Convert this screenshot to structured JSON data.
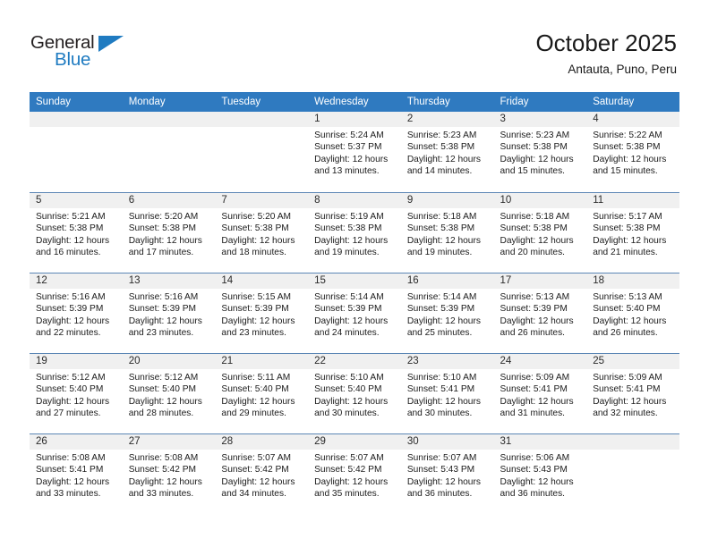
{
  "brand": {
    "name_top": "General",
    "name_bottom": "Blue",
    "triangle_icon": "triangle-icon",
    "accent_color": "#1f7bc1"
  },
  "header": {
    "title": "October 2025",
    "location": "Antauta, Puno, Peru"
  },
  "calendar": {
    "header_bg": "#2f7ac0",
    "day_band_bg": "#f0f0f0",
    "row_divider": "#5b86b5",
    "weekdays": [
      "Sunday",
      "Monday",
      "Tuesday",
      "Wednesday",
      "Thursday",
      "Friday",
      "Saturday"
    ],
    "weeks": [
      [
        {
          "day": "",
          "blank": true
        },
        {
          "day": "",
          "blank": true
        },
        {
          "day": "",
          "blank": true
        },
        {
          "day": "1",
          "sunrise": "Sunrise: 5:24 AM",
          "sunset": "Sunset: 5:37 PM",
          "daylight": "Daylight: 12 hours and 13 minutes."
        },
        {
          "day": "2",
          "sunrise": "Sunrise: 5:23 AM",
          "sunset": "Sunset: 5:38 PM",
          "daylight": "Daylight: 12 hours and 14 minutes."
        },
        {
          "day": "3",
          "sunrise": "Sunrise: 5:23 AM",
          "sunset": "Sunset: 5:38 PM",
          "daylight": "Daylight: 12 hours and 15 minutes."
        },
        {
          "day": "4",
          "sunrise": "Sunrise: 5:22 AM",
          "sunset": "Sunset: 5:38 PM",
          "daylight": "Daylight: 12 hours and 15 minutes."
        }
      ],
      [
        {
          "day": "5",
          "sunrise": "Sunrise: 5:21 AM",
          "sunset": "Sunset: 5:38 PM",
          "daylight": "Daylight: 12 hours and 16 minutes."
        },
        {
          "day": "6",
          "sunrise": "Sunrise: 5:20 AM",
          "sunset": "Sunset: 5:38 PM",
          "daylight": "Daylight: 12 hours and 17 minutes."
        },
        {
          "day": "7",
          "sunrise": "Sunrise: 5:20 AM",
          "sunset": "Sunset: 5:38 PM",
          "daylight": "Daylight: 12 hours and 18 minutes."
        },
        {
          "day": "8",
          "sunrise": "Sunrise: 5:19 AM",
          "sunset": "Sunset: 5:38 PM",
          "daylight": "Daylight: 12 hours and 19 minutes."
        },
        {
          "day": "9",
          "sunrise": "Sunrise: 5:18 AM",
          "sunset": "Sunset: 5:38 PM",
          "daylight": "Daylight: 12 hours and 19 minutes."
        },
        {
          "day": "10",
          "sunrise": "Sunrise: 5:18 AM",
          "sunset": "Sunset: 5:38 PM",
          "daylight": "Daylight: 12 hours and 20 minutes."
        },
        {
          "day": "11",
          "sunrise": "Sunrise: 5:17 AM",
          "sunset": "Sunset: 5:38 PM",
          "daylight": "Daylight: 12 hours and 21 minutes."
        }
      ],
      [
        {
          "day": "12",
          "sunrise": "Sunrise: 5:16 AM",
          "sunset": "Sunset: 5:39 PM",
          "daylight": "Daylight: 12 hours and 22 minutes."
        },
        {
          "day": "13",
          "sunrise": "Sunrise: 5:16 AM",
          "sunset": "Sunset: 5:39 PM",
          "daylight": "Daylight: 12 hours and 23 minutes."
        },
        {
          "day": "14",
          "sunrise": "Sunrise: 5:15 AM",
          "sunset": "Sunset: 5:39 PM",
          "daylight": "Daylight: 12 hours and 23 minutes."
        },
        {
          "day": "15",
          "sunrise": "Sunrise: 5:14 AM",
          "sunset": "Sunset: 5:39 PM",
          "daylight": "Daylight: 12 hours and 24 minutes."
        },
        {
          "day": "16",
          "sunrise": "Sunrise: 5:14 AM",
          "sunset": "Sunset: 5:39 PM",
          "daylight": "Daylight: 12 hours and 25 minutes."
        },
        {
          "day": "17",
          "sunrise": "Sunrise: 5:13 AM",
          "sunset": "Sunset: 5:39 PM",
          "daylight": "Daylight: 12 hours and 26 minutes."
        },
        {
          "day": "18",
          "sunrise": "Sunrise: 5:13 AM",
          "sunset": "Sunset: 5:40 PM",
          "daylight": "Daylight: 12 hours and 26 minutes."
        }
      ],
      [
        {
          "day": "19",
          "sunrise": "Sunrise: 5:12 AM",
          "sunset": "Sunset: 5:40 PM",
          "daylight": "Daylight: 12 hours and 27 minutes."
        },
        {
          "day": "20",
          "sunrise": "Sunrise: 5:12 AM",
          "sunset": "Sunset: 5:40 PM",
          "daylight": "Daylight: 12 hours and 28 minutes."
        },
        {
          "day": "21",
          "sunrise": "Sunrise: 5:11 AM",
          "sunset": "Sunset: 5:40 PM",
          "daylight": "Daylight: 12 hours and 29 minutes."
        },
        {
          "day": "22",
          "sunrise": "Sunrise: 5:10 AM",
          "sunset": "Sunset: 5:40 PM",
          "daylight": "Daylight: 12 hours and 30 minutes."
        },
        {
          "day": "23",
          "sunrise": "Sunrise: 5:10 AM",
          "sunset": "Sunset: 5:41 PM",
          "daylight": "Daylight: 12 hours and 30 minutes."
        },
        {
          "day": "24",
          "sunrise": "Sunrise: 5:09 AM",
          "sunset": "Sunset: 5:41 PM",
          "daylight": "Daylight: 12 hours and 31 minutes."
        },
        {
          "day": "25",
          "sunrise": "Sunrise: 5:09 AM",
          "sunset": "Sunset: 5:41 PM",
          "daylight": "Daylight: 12 hours and 32 minutes."
        }
      ],
      [
        {
          "day": "26",
          "sunrise": "Sunrise: 5:08 AM",
          "sunset": "Sunset: 5:41 PM",
          "daylight": "Daylight: 12 hours and 33 minutes."
        },
        {
          "day": "27",
          "sunrise": "Sunrise: 5:08 AM",
          "sunset": "Sunset: 5:42 PM",
          "daylight": "Daylight: 12 hours and 33 minutes."
        },
        {
          "day": "28",
          "sunrise": "Sunrise: 5:07 AM",
          "sunset": "Sunset: 5:42 PM",
          "daylight": "Daylight: 12 hours and 34 minutes."
        },
        {
          "day": "29",
          "sunrise": "Sunrise: 5:07 AM",
          "sunset": "Sunset: 5:42 PM",
          "daylight": "Daylight: 12 hours and 35 minutes."
        },
        {
          "day": "30",
          "sunrise": "Sunrise: 5:07 AM",
          "sunset": "Sunset: 5:43 PM",
          "daylight": "Daylight: 12 hours and 36 minutes."
        },
        {
          "day": "31",
          "sunrise": "Sunrise: 5:06 AM",
          "sunset": "Sunset: 5:43 PM",
          "daylight": "Daylight: 12 hours and 36 minutes."
        },
        {
          "day": "",
          "blank": true
        }
      ]
    ]
  }
}
